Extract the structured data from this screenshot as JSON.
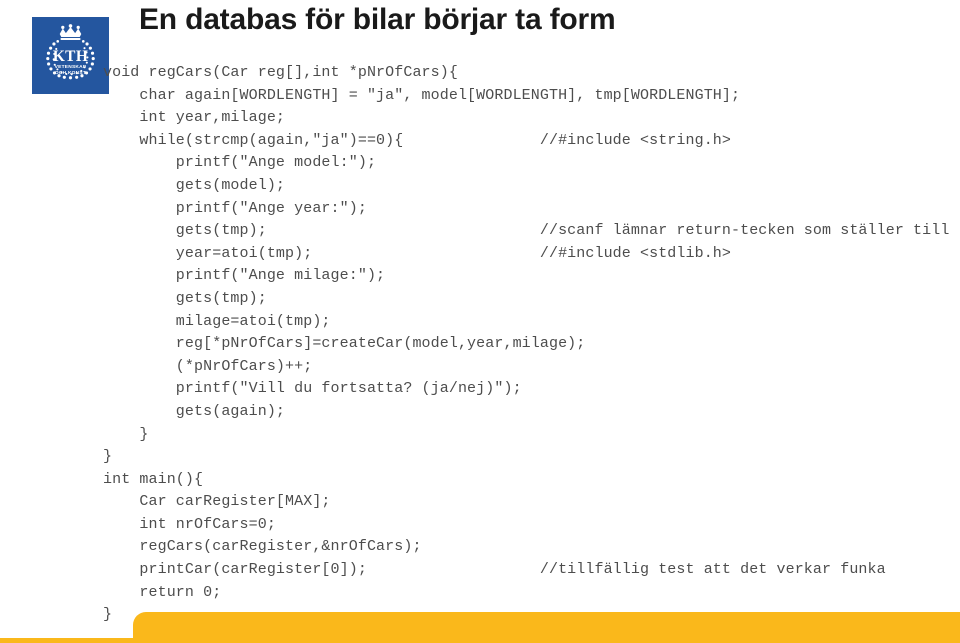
{
  "slide": {
    "title": "En databas för bilar börjar ta form",
    "logo": {
      "name": "kth-logo",
      "acronym": "KTH",
      "motto_line1": "VETENSKAP",
      "motto_line2": "OCH KONST",
      "background_color": "#24569f"
    },
    "theme": {
      "accent_color": "#fab81b",
      "code_text_color": "#4d4d4d",
      "title_color": "#1a1a1a",
      "background_color": "#ffffff"
    },
    "code": {
      "language": "c",
      "lines": [
        {
          "text": "void regCars(Car reg[],int *pNrOfCars){",
          "comment": ""
        },
        {
          "text": "    char again[WORDLENGTH] = \"ja\", model[WORDLENGTH], tmp[WORDLENGTH];",
          "comment": ""
        },
        {
          "text": "    int year,milage;",
          "comment": ""
        },
        {
          "text": "    while(strcmp(again,\"ja\")==0){",
          "comment": "//#include <string.h>"
        },
        {
          "text": "        printf(\"Ange model:\");",
          "comment": ""
        },
        {
          "text": "        gets(model);",
          "comment": ""
        },
        {
          "text": "        printf(\"Ange year:\");",
          "comment": ""
        },
        {
          "text": "        gets(tmp);",
          "comment": "//scanf lämnar return-tecken som ställer till"
        },
        {
          "text": "        year=atoi(tmp);",
          "comment": "//#include <stdlib.h>"
        },
        {
          "text": "        printf(\"Ange milage:\");",
          "comment": ""
        },
        {
          "text": "        gets(tmp);",
          "comment": ""
        },
        {
          "text": "        milage=atoi(tmp);",
          "comment": ""
        },
        {
          "text": "        reg[*pNrOfCars]=createCar(model,year,milage);",
          "comment": ""
        },
        {
          "text": "        (*pNrOfCars)++;",
          "comment": ""
        },
        {
          "text": "        printf(\"Vill du fortsatta? (ja/nej)\");",
          "comment": ""
        },
        {
          "text": "        gets(again);",
          "comment": ""
        },
        {
          "text": "    }",
          "comment": ""
        },
        {
          "text": "}",
          "comment": ""
        },
        {
          "text": "int main(){",
          "comment": ""
        },
        {
          "text": "    Car carRegister[MAX];",
          "comment": ""
        },
        {
          "text": "    int nrOfCars=0;",
          "comment": ""
        },
        {
          "text": "    regCars(carRegister,&nrOfCars);",
          "comment": ""
        },
        {
          "text": "    printCar(carRegister[0]);",
          "comment": "//tillfällig test att det verkar funka"
        },
        {
          "text": "    return 0;",
          "comment": ""
        },
        {
          "text": "}",
          "comment": ""
        }
      ],
      "comment_column": 48
    }
  }
}
